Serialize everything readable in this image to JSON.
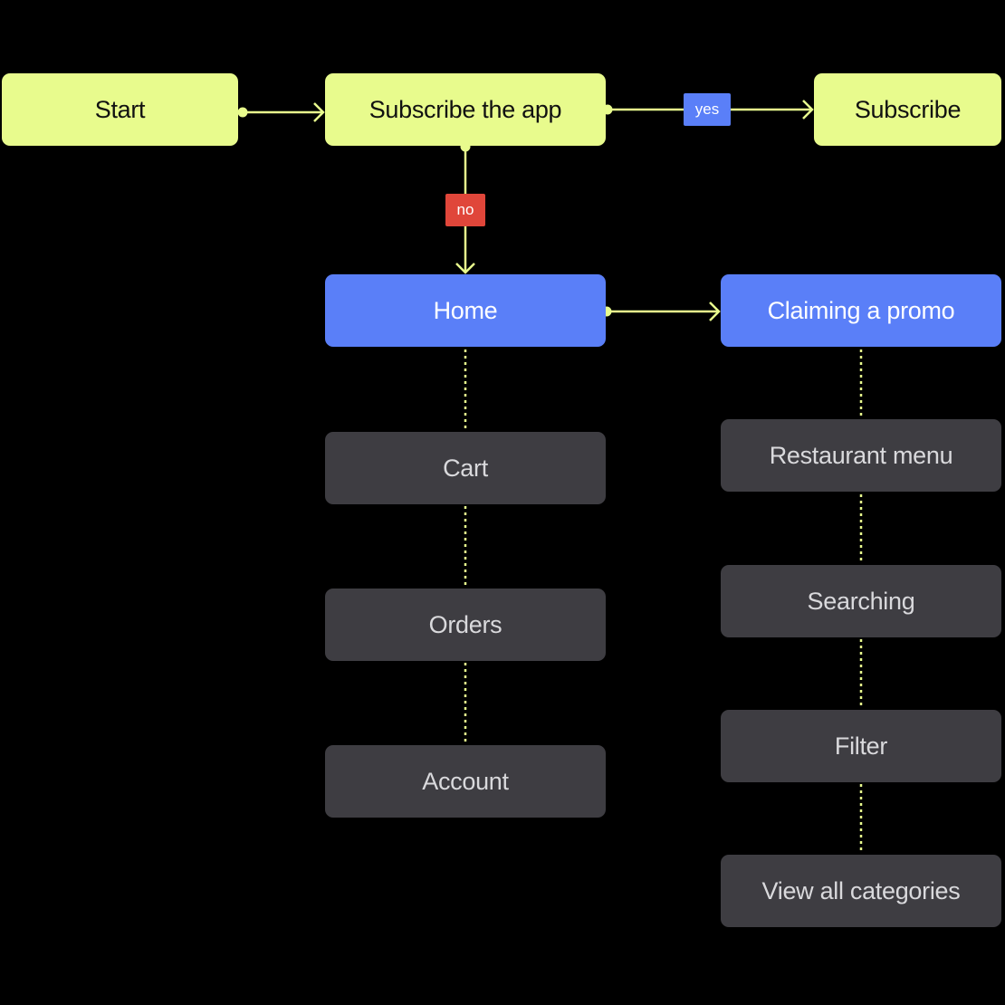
{
  "colors": {
    "lime": "#e8fb8d",
    "blue": "#5a7ff8",
    "gray": "#3e3d42",
    "no_tag": "#e0463a",
    "connector": "#e8fb8d"
  },
  "nodes": {
    "start": "Start",
    "subscribe_app": "Subscribe the app",
    "subscribe": "Subscribe",
    "home": "Home",
    "claiming_promo": "Claiming a promo",
    "cart": "Cart",
    "orders": "Orders",
    "account": "Account",
    "restaurant_menu": "Restaurant menu",
    "searching": "Searching",
    "filter": "Filter",
    "view_all_categories": "View all categories"
  },
  "edges": {
    "yes": "yes",
    "no": "no"
  }
}
